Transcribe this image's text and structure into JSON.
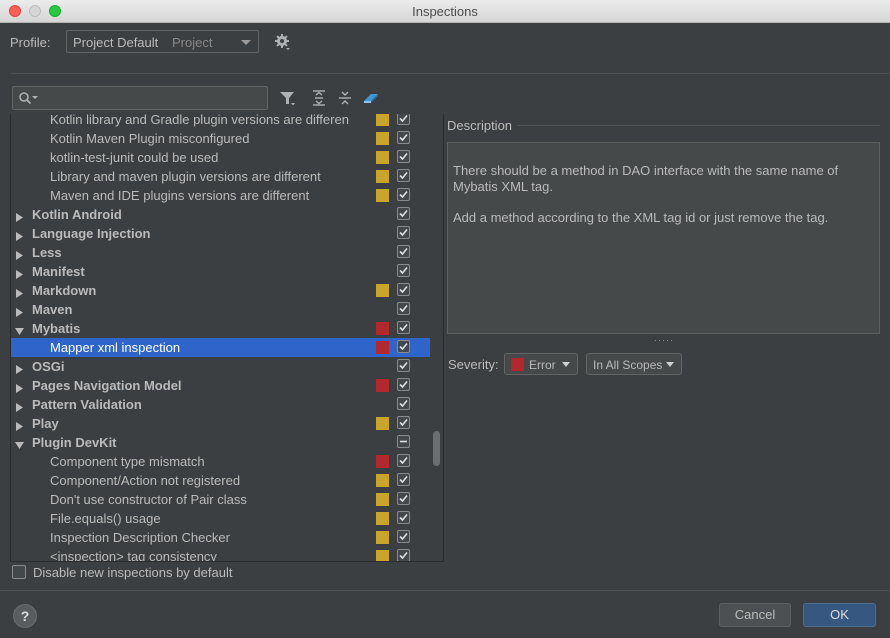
{
  "window": {
    "title": "Inspections"
  },
  "profile": {
    "label": "Profile:",
    "name": "Project Default",
    "scope": "Project"
  },
  "colors": {
    "warning": "#c9a52a",
    "error": "#b3282d",
    "selection": "#2f65ca"
  },
  "tree": {
    "rows": [
      {
        "label": "Kotlin library and Gradle plugin versions are differen",
        "kind": "child",
        "severity": "warning",
        "checked": true
      },
      {
        "label": "Kotlin Maven Plugin misconfigured",
        "kind": "child",
        "severity": "warning",
        "checked": true
      },
      {
        "label": "kotlin-test-junit could be used",
        "kind": "child",
        "severity": "warning",
        "checked": true
      },
      {
        "label": "Library and maven plugin versions are different",
        "kind": "child",
        "severity": "warning",
        "checked": true
      },
      {
        "label": "Maven and IDE plugins versions are different",
        "kind": "child",
        "severity": "warning",
        "checked": true
      },
      {
        "label": "Kotlin Android",
        "kind": "group",
        "expanded": false,
        "severity": "",
        "checked": true
      },
      {
        "label": "Language Injection",
        "kind": "group",
        "expanded": false,
        "severity": "",
        "checked": true
      },
      {
        "label": "Less",
        "kind": "group",
        "expanded": false,
        "severity": "",
        "checked": true
      },
      {
        "label": "Manifest",
        "kind": "group",
        "expanded": false,
        "severity": "",
        "checked": true
      },
      {
        "label": "Markdown",
        "kind": "group",
        "expanded": false,
        "severity": "warning",
        "checked": true
      },
      {
        "label": "Maven",
        "kind": "group",
        "expanded": false,
        "severity": "",
        "checked": true
      },
      {
        "label": "Mybatis",
        "kind": "group",
        "expanded": true,
        "severity": "error",
        "checked": true
      },
      {
        "label": "Mapper xml inspection",
        "kind": "child",
        "severity": "error",
        "checked": true,
        "selected": true
      },
      {
        "label": "OSGi",
        "kind": "group",
        "expanded": false,
        "severity": "",
        "checked": true
      },
      {
        "label": "Pages Navigation Model",
        "kind": "group",
        "expanded": false,
        "severity": "error",
        "checked": true
      },
      {
        "label": "Pattern Validation",
        "kind": "group",
        "expanded": false,
        "severity": "",
        "checked": true
      },
      {
        "label": "Play",
        "kind": "group",
        "expanded": false,
        "severity": "warning",
        "checked": true
      },
      {
        "label": "Plugin DevKit",
        "kind": "group",
        "expanded": true,
        "severity": "",
        "checked": "partial"
      },
      {
        "label": "Component type mismatch",
        "kind": "child",
        "severity": "error",
        "checked": true
      },
      {
        "label": "Component/Action not registered",
        "kind": "child",
        "severity": "warning",
        "checked": true
      },
      {
        "label": "Don't use constructor of Pair class",
        "kind": "child",
        "severity": "warning",
        "checked": true
      },
      {
        "label": "File.equals() usage",
        "kind": "child",
        "severity": "warning",
        "checked": true
      },
      {
        "label": "Inspection Description Checker",
        "kind": "child",
        "severity": "warning",
        "checked": true
      },
      {
        "label": "<inspection> tag consistency",
        "kind": "child",
        "severity": "warning",
        "checked": true
      }
    ]
  },
  "description": {
    "label": "Description",
    "paragraphs": [
      "There should be a method in DAO interface with the same name of Mybatis XML tag.",
      "Add a method according to the XML tag id or just remove the tag."
    ]
  },
  "severity": {
    "label": "Severity:",
    "value": "Error",
    "scope": "In All Scopes"
  },
  "options": {
    "disable_new_label": "Disable new inspections by default"
  },
  "buttons": {
    "help": "?",
    "cancel": "Cancel",
    "ok": "OK"
  }
}
